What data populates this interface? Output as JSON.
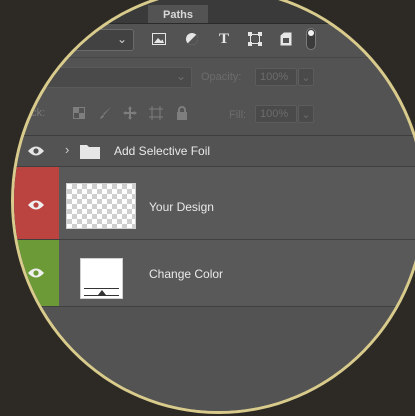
{
  "panel": {
    "tabs": [
      {
        "label": "Paths"
      }
    ]
  },
  "filter_bar": {
    "kind_select_value": "",
    "icons": [
      "image-filter-icon",
      "adjustment-filter-icon",
      "type-filter-icon",
      "shape-filter-icon",
      "smart-object-filter-icon"
    ]
  },
  "blend_row": {
    "blend_mode": "rmal",
    "opacity_label": "Opacity:",
    "opacity_value": "100%"
  },
  "lock_row": {
    "lock_label": "ock:",
    "fill_label": "Fill:",
    "fill_value": "100%"
  },
  "layers": [
    {
      "name": "Add Selective Foil",
      "type": "group",
      "visibility_color": "#535353"
    },
    {
      "name": "Your Design",
      "type": "pixel",
      "visibility_color": "#bb4340"
    },
    {
      "name": "Change Color",
      "type": "adjustment",
      "visibility_color": "#6b9a37"
    }
  ],
  "colors": {
    "lens_border": "#d8cb8c",
    "background": "#2d2a25",
    "panel": "#535353"
  }
}
